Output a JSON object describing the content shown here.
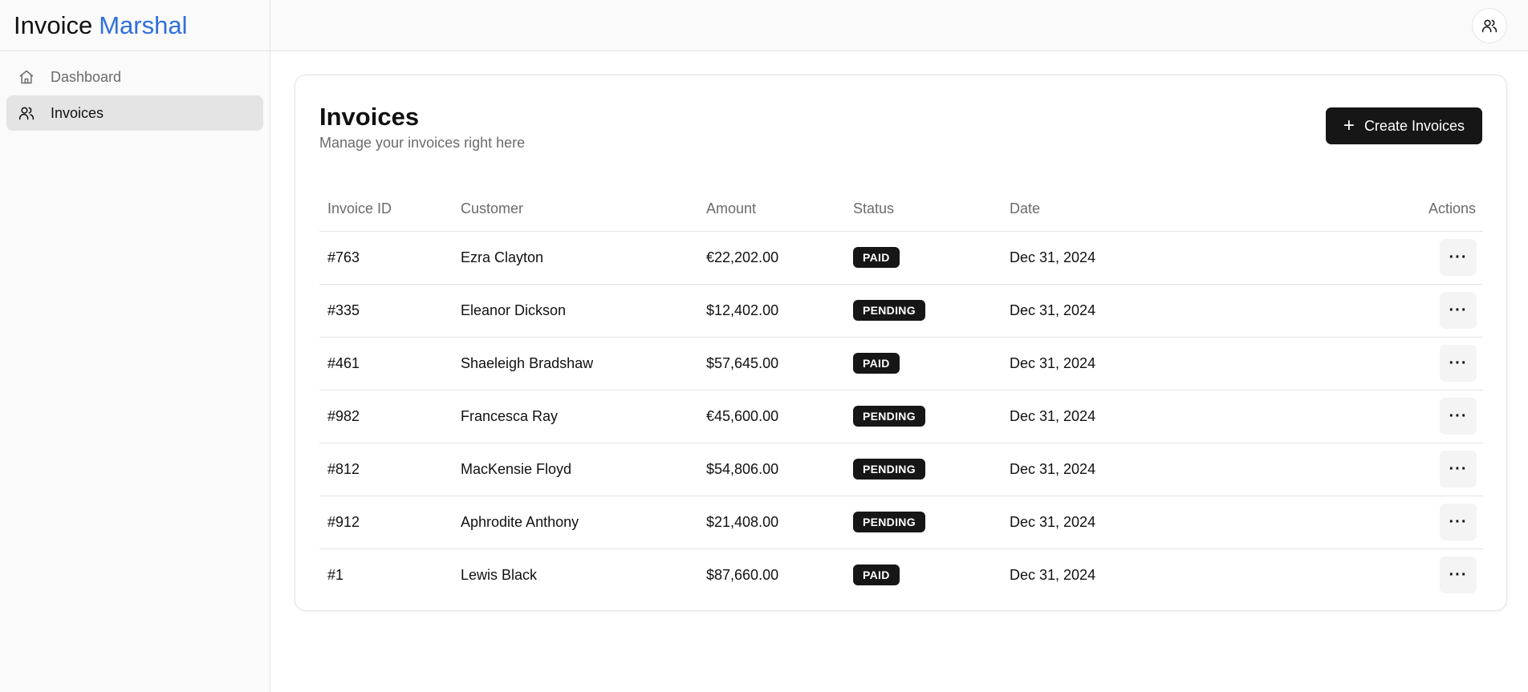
{
  "brand": {
    "name": "Invoice",
    "accent": "Marshal",
    "accent_color": "#2f6fdc"
  },
  "sidebar": {
    "items": [
      {
        "label": "Dashboard",
        "icon": "home-icon",
        "active": false
      },
      {
        "label": "Invoices",
        "icon": "users-icon",
        "active": true
      }
    ]
  },
  "topbar": {
    "avatar_icon": "users-icon"
  },
  "page": {
    "title": "Invoices",
    "subtitle": "Manage your invoices right here",
    "create_button": "Create Invoices"
  },
  "table": {
    "columns": [
      "Invoice ID",
      "Customer",
      "Amount",
      "Status",
      "Date",
      "Actions"
    ],
    "rows": [
      {
        "id": "#763",
        "customer": "Ezra Clayton",
        "amount": "€22,202.00",
        "status": "PAID",
        "date": "Dec 31, 2024"
      },
      {
        "id": "#335",
        "customer": "Eleanor Dickson",
        "amount": "$12,402.00",
        "status": "PENDING",
        "date": "Dec 31, 2024"
      },
      {
        "id": "#461",
        "customer": "Shaeleigh Bradshaw",
        "amount": "$57,645.00",
        "status": "PAID",
        "date": "Dec 31, 2024"
      },
      {
        "id": "#982",
        "customer": "Francesca Ray",
        "amount": "€45,600.00",
        "status": "PENDING",
        "date": "Dec 31, 2024"
      },
      {
        "id": "#812",
        "customer": "MacKensie Floyd",
        "amount": "$54,806.00",
        "status": "PENDING",
        "date": "Dec 31, 2024"
      },
      {
        "id": "#912",
        "customer": "Aphrodite Anthony",
        "amount": "$21,408.00",
        "status": "PENDING",
        "date": "Dec 31, 2024"
      },
      {
        "id": "#1",
        "customer": "Lewis Black",
        "amount": "$87,660.00",
        "status": "PAID",
        "date": "Dec 31, 2024"
      }
    ],
    "actions_label": "···"
  }
}
